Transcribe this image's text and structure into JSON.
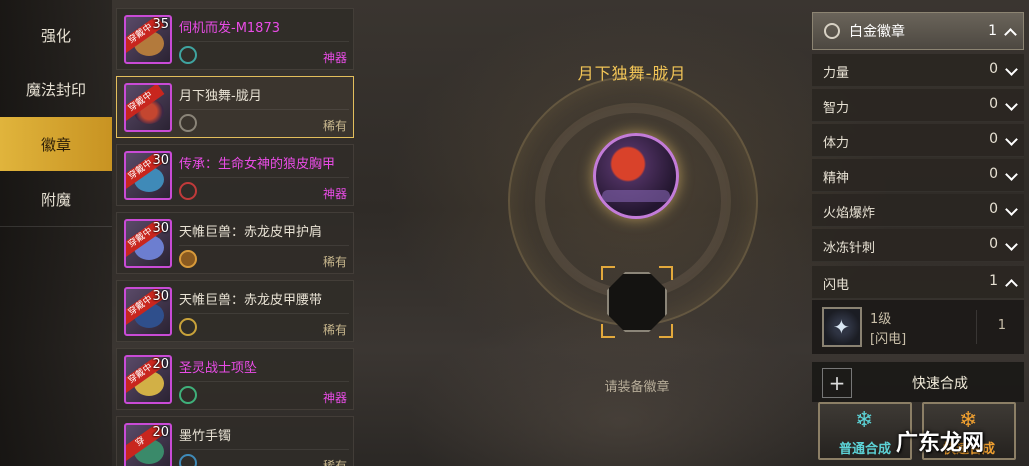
{
  "nav": {
    "items": [
      {
        "label": "强化"
      },
      {
        "label": "魔法封印"
      },
      {
        "label": "徽章",
        "active": true
      },
      {
        "label": "附魔"
      }
    ]
  },
  "items": [
    {
      "level": "35",
      "badge": "穿戴中",
      "name": "伺机而发-M1873",
      "rarity": "神器",
      "art_color": "#b37a3c",
      "slot_color": "#3fa4a0"
    },
    {
      "level": "",
      "badge": "穿戴中",
      "name": "月下独舞-胧月",
      "rarity": "稀有",
      "art_color": "#c44630",
      "slot_color": "#8a8478",
      "selected": true
    },
    {
      "level": "30",
      "badge": "穿戴中",
      "name": "传承：生命女神的狼皮胸甲",
      "rarity": "神器",
      "art_color": "#3f8ab8",
      "slot_color": "#c03a3a"
    },
    {
      "level": "30",
      "badge": "穿戴中",
      "name": "天帷巨兽：赤龙皮甲护肩",
      "rarity": "稀有",
      "art_color": "#6c7ed0",
      "slot_color": "#d89a3a"
    },
    {
      "level": "30",
      "badge": "穿戴中",
      "name": "天帷巨兽：赤龙皮甲腰带",
      "rarity": "稀有",
      "art_color": "#2f4f8c",
      "slot_color": "#c8a23a"
    },
    {
      "level": "20",
      "badge": "穿戴中",
      "name": "圣灵战士项坠",
      "rarity": "神器",
      "art_color": "#d2b046",
      "slot_color": "#3fb07a"
    },
    {
      "level": "20",
      "badge": "穿",
      "name": "墨竹手镯",
      "rarity": "稀有",
      "art_color": "#3a8a6a",
      "slot_color": "#3f8ab8"
    }
  ],
  "center": {
    "title": "月下独舞-胧月",
    "hint": "请装备徽章"
  },
  "filter": {
    "header": {
      "label": "白金徽章",
      "count": "1"
    },
    "rows": [
      {
        "label": "力量",
        "count": "0"
      },
      {
        "label": "智力",
        "count": "0"
      },
      {
        "label": "体力",
        "count": "0"
      },
      {
        "label": "精神",
        "count": "0"
      },
      {
        "label": "火焰爆炸",
        "count": "0"
      },
      {
        "label": "冰冻针刺",
        "count": "0"
      },
      {
        "label": "闪电",
        "count": "1",
        "expanded": true
      }
    ],
    "sub": {
      "line1": "1级",
      "line2": "[闪电]",
      "count": "1"
    }
  },
  "quick": {
    "label": "快速合成"
  },
  "buttons": {
    "normal": "普通合成",
    "quick": "快速合成"
  },
  "watermark": "广东龙网",
  "colors": {
    "accent": "#e0b43c",
    "shenqi": "#e94ce6",
    "xiyou": "#c9b88e",
    "title": "#f1c456"
  }
}
